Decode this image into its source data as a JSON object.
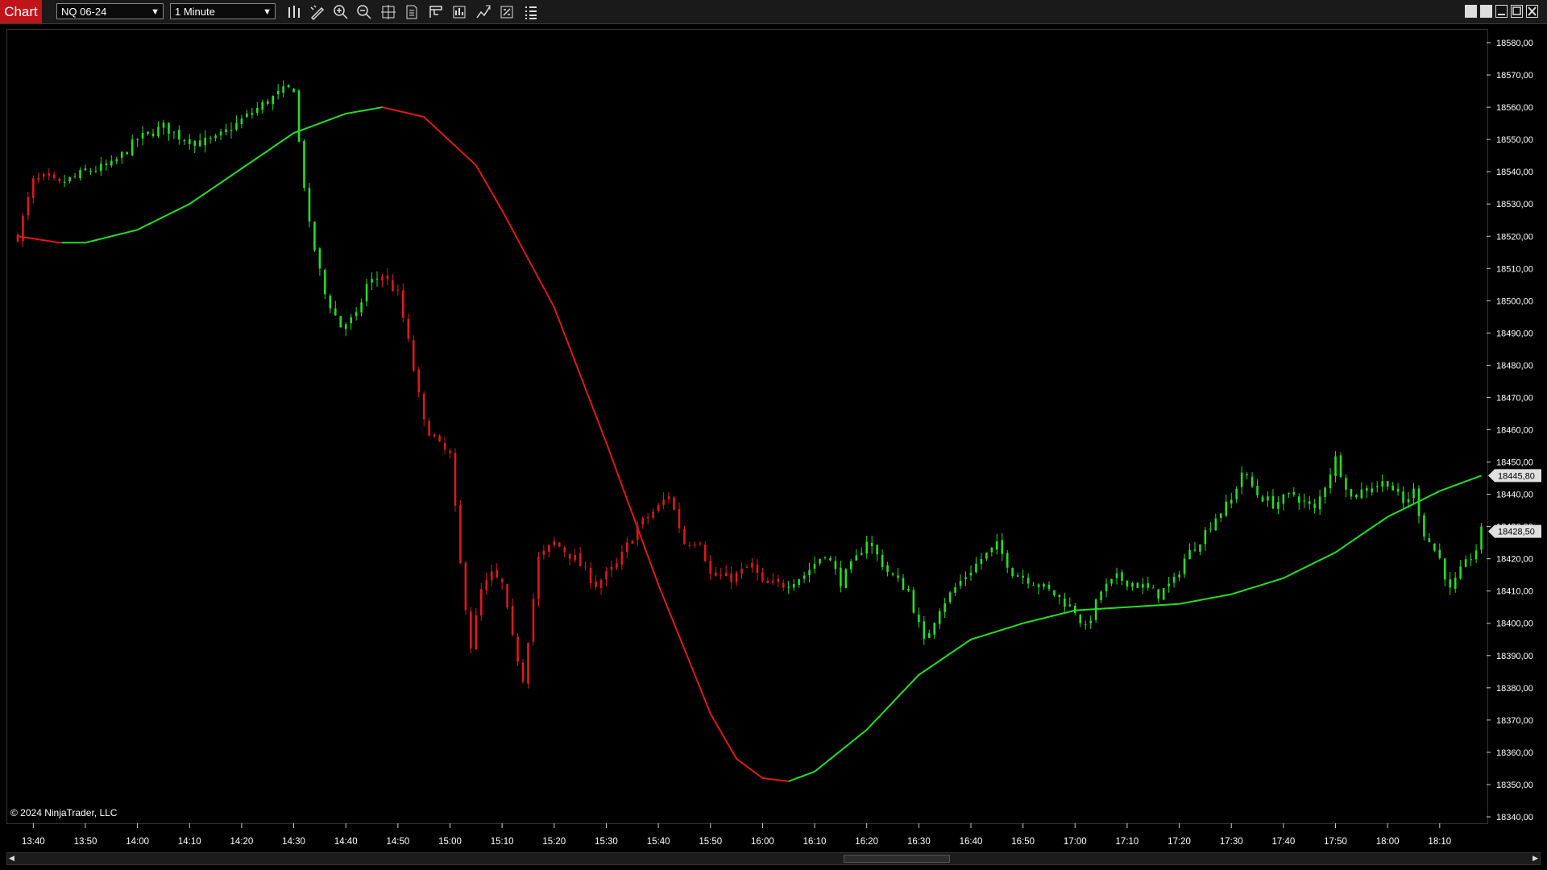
{
  "toolbar": {
    "tab_label": "Chart",
    "instrument": "NQ 06-24",
    "interval": "1 Minute",
    "tools": [
      "bars-type-icon",
      "drawing-tool-icon",
      "zoom-in-icon",
      "zoom-out-icon",
      "crosshair-icon",
      "chart-trader-icon",
      "data-box-icon",
      "properties-icon",
      "indicators-icon",
      "strategies-icon",
      "object-list-icon"
    ],
    "window_buttons": [
      "tile-icon",
      "tile-alt-icon",
      "minimize-icon",
      "maximize-icon",
      "close-icon"
    ]
  },
  "colors": {
    "up": "#22e022",
    "down": "#e01818",
    "background": "#000000",
    "tab": "#c0141b"
  },
  "copyright": "© 2024 NinjaTrader, LLC",
  "chart_data": {
    "type": "candlestick",
    "instrument": "NQ 06-24",
    "interval": "1 Minute",
    "y_ticks": [
      "18580,00",
      "18570,00",
      "18560,00",
      "18550,00",
      "18540,00",
      "18530,00",
      "18520,00",
      "18510,00",
      "18500,00",
      "18490,00",
      "18480,00",
      "18470,00",
      "18460,00",
      "18450,00",
      "18440,00",
      "18430,00",
      "18420,00",
      "18410,00",
      "18400,00",
      "18390,00",
      "18380,00",
      "18370,00",
      "18360,00",
      "18350,00",
      "18340,00"
    ],
    "x_ticks": [
      "13:40",
      "13:50",
      "14:00",
      "14:10",
      "14:20",
      "14:30",
      "14:40",
      "14:50",
      "15:00",
      "15:10",
      "15:20",
      "15:30",
      "15:40",
      "15:50",
      "16:00",
      "16:10",
      "16:20",
      "16:30",
      "16:40",
      "16:50",
      "17:00",
      "17:10",
      "17:20",
      "17:30",
      "17:40",
      "17:50",
      "18:00",
      "18:10"
    ],
    "ylim": [
      18338,
      18584
    ],
    "xlim": [
      "13:35",
      "18:19"
    ],
    "price_labels": [
      {
        "label": "18445,80",
        "value": 18445.8,
        "color": "#e0e0e0"
      },
      {
        "label": "18428,50",
        "value": 18428.5,
        "color": "#e0e0e0"
      }
    ],
    "close_path": [
      [
        "13:37",
        18520
      ],
      [
        "13:40",
        18537
      ],
      [
        "13:42",
        18538
      ],
      [
        "13:45",
        18536
      ],
      [
        "13:50",
        18540
      ],
      [
        "13:55",
        18542
      ],
      [
        "14:00",
        18550
      ],
      [
        "14:05",
        18554
      ],
      [
        "14:08",
        18551
      ],
      [
        "14:12",
        18549
      ],
      [
        "14:15",
        18550
      ],
      [
        "14:20",
        18556
      ],
      [
        "14:25",
        18562
      ],
      [
        "14:28",
        18565
      ],
      [
        "14:30",
        18566
      ],
      [
        "14:31",
        18549
      ],
      [
        "14:33",
        18523
      ],
      [
        "14:36",
        18502
      ],
      [
        "14:39",
        18492
      ],
      [
        "14:42",
        18495
      ],
      [
        "14:44",
        18505
      ],
      [
        "14:47",
        18508
      ],
      [
        "14:50",
        18502
      ],
      [
        "14:52",
        18487
      ],
      [
        "14:55",
        18462
      ],
      [
        "14:58",
        18455
      ],
      [
        "15:00",
        18452
      ],
      [
        "15:02",
        18418
      ],
      [
        "15:04",
        18393
      ],
      [
        "15:06",
        18410
      ],
      [
        "15:08",
        18415
      ],
      [
        "15:10",
        18412
      ],
      [
        "15:12",
        18395
      ],
      [
        "15:14",
        18383
      ],
      [
        "15:17",
        18420
      ],
      [
        "15:20",
        18425
      ],
      [
        "15:24",
        18420
      ],
      [
        "15:28",
        18412
      ],
      [
        "15:32",
        18418
      ],
      [
        "15:36",
        18430
      ],
      [
        "15:40",
        18436
      ],
      [
        "15:42",
        18440
      ],
      [
        "15:45",
        18425
      ],
      [
        "15:48",
        18426
      ],
      [
        "15:50",
        18415
      ],
      [
        "15:54",
        18414
      ],
      [
        "15:58",
        18418
      ],
      [
        "16:00",
        18412
      ],
      [
        "16:04",
        18412
      ],
      [
        "16:08",
        18415
      ],
      [
        "16:12",
        18422
      ],
      [
        "16:15",
        18413
      ],
      [
        "16:18",
        18420
      ],
      [
        "16:20",
        18426
      ],
      [
        "16:24",
        18416
      ],
      [
        "16:28",
        18410
      ],
      [
        "16:31",
        18394
      ],
      [
        "16:34",
        18405
      ],
      [
        "16:38",
        18413
      ],
      [
        "16:42",
        18420
      ],
      [
        "16:45",
        18424
      ],
      [
        "16:48",
        18416
      ],
      [
        "16:52",
        18413
      ],
      [
        "16:56",
        18409
      ],
      [
        "17:00",
        18404
      ],
      [
        "17:02",
        18398
      ],
      [
        "17:05",
        18410
      ],
      [
        "17:08",
        18414
      ],
      [
        "17:12",
        18412
      ],
      [
        "17:16",
        18409
      ],
      [
        "17:19",
        18413
      ],
      [
        "17:21",
        18420
      ],
      [
        "17:24",
        18426
      ],
      [
        "17:27",
        18433
      ],
      [
        "17:30",
        18438
      ],
      [
        "17:32",
        18447
      ],
      [
        "17:35",
        18440
      ],
      [
        "17:38",
        18437
      ],
      [
        "17:42",
        18440
      ],
      [
        "17:46",
        18435
      ],
      [
        "17:48",
        18443
      ],
      [
        "17:50",
        18451
      ],
      [
        "17:53",
        18439
      ],
      [
        "17:56",
        18442
      ],
      [
        "18:00",
        18444
      ],
      [
        "18:03",
        18437
      ],
      [
        "18:05",
        18441
      ],
      [
        "18:07",
        18428
      ],
      [
        "18:10",
        18420
      ],
      [
        "18:12",
        18410
      ],
      [
        "18:14",
        18416
      ],
      [
        "18:17",
        18423
      ],
      [
        "18:18",
        18428.5
      ]
    ],
    "smoothed_line": [
      [
        "13:37",
        18520
      ],
      [
        "13:45",
        18518
      ],
      [
        "13:50",
        18518
      ],
      [
        "14:00",
        18522
      ],
      [
        "14:10",
        18530
      ],
      [
        "14:20",
        18541
      ],
      [
        "14:30",
        18552
      ],
      [
        "14:40",
        18558
      ],
      [
        "14:47",
        18560
      ],
      [
        "14:55",
        18557
      ],
      [
        "15:05",
        18542
      ],
      [
        "15:10",
        18528
      ],
      [
        "15:20",
        18498
      ],
      [
        "15:30",
        18456
      ],
      [
        "15:40",
        18412
      ],
      [
        "15:50",
        18372
      ],
      [
        "15:55",
        18358
      ],
      [
        "16:00",
        18352
      ],
      [
        "16:05",
        18351
      ],
      [
        "16:10",
        18354
      ],
      [
        "16:20",
        18367
      ],
      [
        "16:30",
        18384
      ],
      [
        "16:40",
        18395
      ],
      [
        "16:50",
        18400
      ],
      [
        "17:00",
        18404
      ],
      [
        "17:10",
        18405
      ],
      [
        "17:20",
        18406
      ],
      [
        "17:30",
        18409
      ],
      [
        "17:40",
        18414
      ],
      [
        "17:50",
        18422
      ],
      [
        "18:00",
        18433
      ],
      [
        "18:10",
        18441
      ],
      [
        "18:18",
        18445.8
      ]
    ],
    "smoothed_line_color_rule": "green when rising, red when falling"
  }
}
